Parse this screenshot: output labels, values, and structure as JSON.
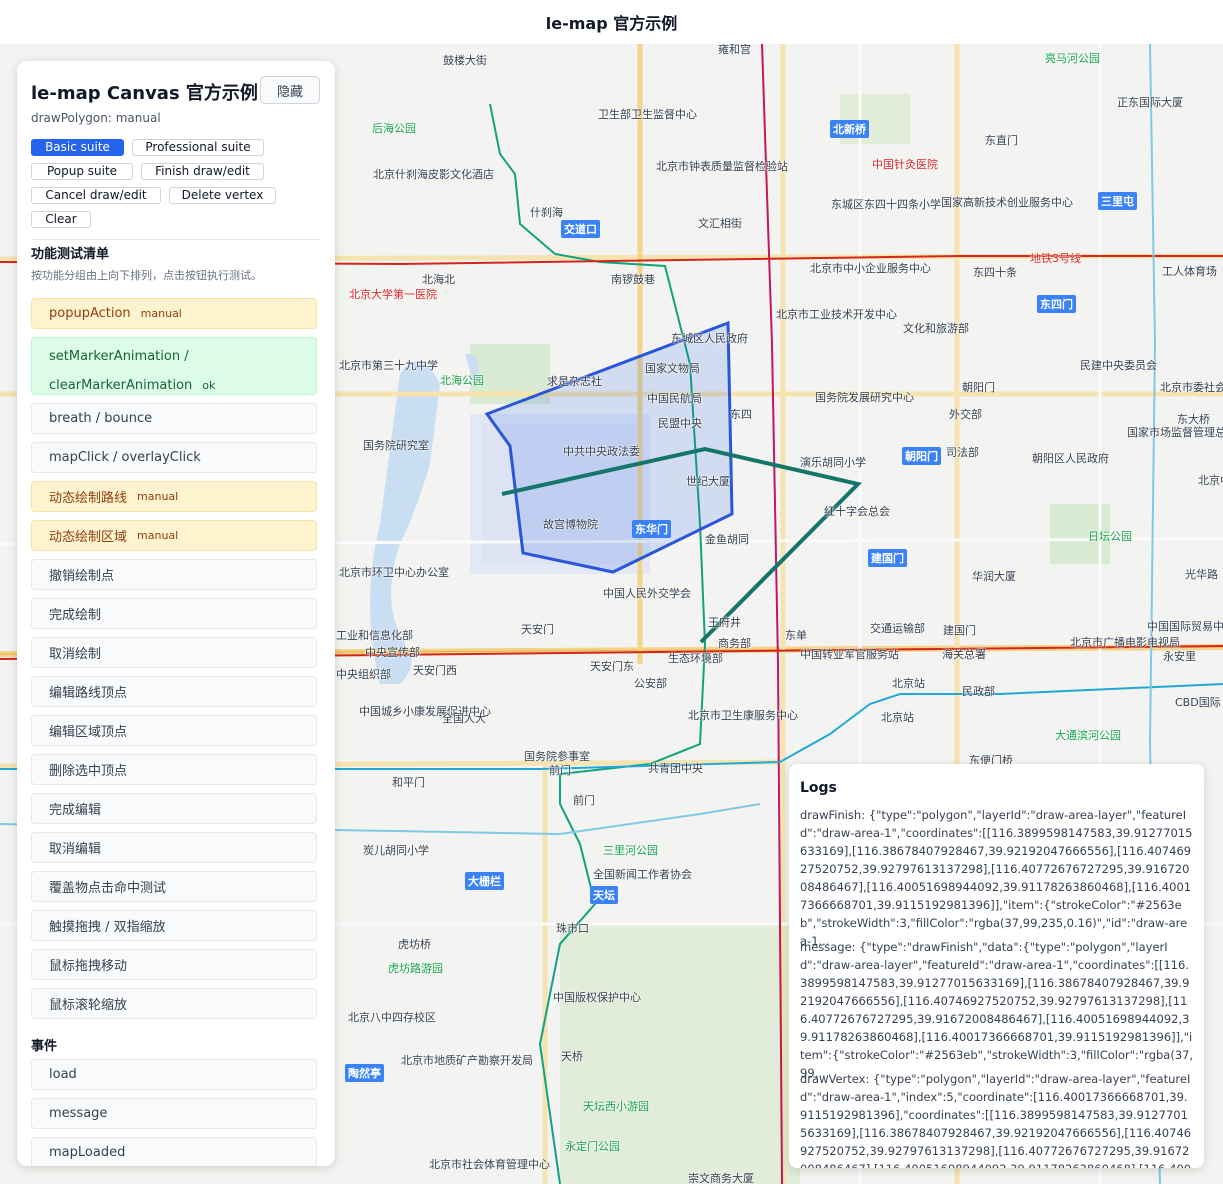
{
  "header": {
    "title": "le-map 官方示例"
  },
  "panel": {
    "title": "le-map Canvas 官方示例",
    "hide_label": "隐藏",
    "subtitle": "drawPolygon: manual",
    "buttons": [
      "Basic suite",
      "Professional suite",
      "Popup suite",
      "Finish draw/edit",
      "Cancel draw/edit",
      "Delete vertex",
      "Clear"
    ],
    "active_button": "Basic suite",
    "checklist_title": "功能测试清单",
    "checklist_desc": "按功能分组由上向下排列，点击按钮执行测试。",
    "items": [
      {
        "label": "popupAction",
        "tag": "manual",
        "status": "warn"
      },
      {
        "label": "setMarkerAnimation /",
        "label2": "clearMarkerAnimation",
        "tag": "ok",
        "status": "ok"
      },
      {
        "label": "breath / bounce",
        "tag": "",
        "status": "none"
      },
      {
        "label": "mapClick / overlayClick",
        "tag": "",
        "status": "none"
      },
      {
        "label": "动态绘制路线",
        "tag": "manual",
        "status": "warn"
      },
      {
        "label": "动态绘制区域",
        "tag": "manual",
        "status": "warn"
      },
      {
        "label": "撤销绘制点",
        "tag": "",
        "status": "none"
      },
      {
        "label": "完成绘制",
        "tag": "",
        "status": "none"
      },
      {
        "label": "取消绘制",
        "tag": "",
        "status": "none"
      },
      {
        "label": "编辑路线顶点",
        "tag": "",
        "status": "none"
      },
      {
        "label": "编辑区域顶点",
        "tag": "",
        "status": "none"
      },
      {
        "label": "删除选中顶点",
        "tag": "",
        "status": "none"
      },
      {
        "label": "完成编辑",
        "tag": "",
        "status": "none"
      },
      {
        "label": "取消编辑",
        "tag": "",
        "status": "none"
      },
      {
        "label": "覆盖物点击命中测试",
        "tag": "",
        "status": "none"
      },
      {
        "label": "触摸拖拽 / 双指缩放",
        "tag": "",
        "status": "none"
      },
      {
        "label": "鼠标拖拽移动",
        "tag": "",
        "status": "none"
      },
      {
        "label": "鼠标滚轮缩放",
        "tag": "",
        "status": "none"
      }
    ],
    "events_title": "事件",
    "events": [
      "load",
      "message",
      "mapLoaded"
    ]
  },
  "logs": {
    "title": "Logs",
    "entries": [
      "drawFinish: {\"type\":\"polygon\",\"layerId\":\"draw-area-layer\",\"featureId\":\"draw-area-1\",\"coordinates\":[[116.3899598147583,39.91277015633169],[116.38678407928467,39.92192047666556],[116.40746927520752,39.92797613137298],[116.40772676727295,39.91672008486467],[116.40051698944092,39.91178263860468],[116.40017366668701,39.9115192981396]],\"item\":{\"strokeColor\":\"#2563eb\",\"strokeWidth\":3,\"fillColor\":\"rgba(37,99,235,0.16)\",\"id\":\"draw-area-1...",
      "message: {\"type\":\"drawFinish\",\"data\":{\"type\":\"polygon\",\"layerId\":\"draw-area-layer\",\"featureId\":\"draw-area-1\",\"coordinates\":[[116.3899598147583,39.91277015633169],[116.38678407928467,39.92192047666556],[116.40746927520752,39.92797613137298],[116.40772676727295,39.91672008486467],[116.40051698944092,39.91178263860468],[116.40017366668701,39.9115192981396]],\"item\":{\"strokeColor\":\"#2563eb\",\"strokeWidth\":3,\"fillColor\":\"rgba(37,99,...",
      "drawVertex: {\"type\":\"polygon\",\"layerId\":\"draw-area-layer\",\"featureId\":\"draw-area-1\",\"index\":5,\"coordinate\":[116.40017366668701,39.9115192981396],\"coordinates\":[[116.3899598147583,39.91277015633169],[116.38678407928467,39.92192047666556],[116.40746927520752,39.92797613137298],[116.40772676727295,39.91672008486467],[116.40051698944092,39.91178263860468],[116.40017366668701,39.9..."
    ]
  },
  "map": {
    "labels": [
      "鼓楼大街",
      "雍和宫",
      "亮马河公园",
      "正东国际大厦",
      "卫生部卫生监督中心",
      "北新桥",
      "东直门",
      "后海公园",
      "中国针灸医院",
      "北京市钟表质量监督检验站",
      "北京什刹海皮影文化酒店",
      "东城区东四十四条小学",
      "国家高新技术创业服务中心",
      "三里屯",
      "什刹海",
      "交道口",
      "文汇相街",
      "地铁3号线",
      "北京市中小企业服务中心",
      "东四十条",
      "工人体育场",
      "北海北",
      "南锣鼓巷",
      "北京大学第一医院",
      "北京市工业技术开发中心",
      "东四门",
      "文化和旅游部",
      "东城区人民政府",
      "民建中央委员会",
      "北京市第三十九中学",
      "北海公园",
      "求是杂志社",
      "国家文物局",
      "北京市委社会工作委员会",
      "中国民航局",
      "国务院发展研究中心",
      "朝阳门",
      "东大桥",
      "外交部",
      "国家市场监督管理总局",
      "民盟中央",
      "东四",
      "国务院研究室",
      "中共中央政法委",
      "朝阳门",
      "司法部",
      "朝阳区人民政府",
      "演乐胡同小学",
      "世纪大厦",
      "北京中心",
      "日坛公园",
      "故宫博物院",
      "东华门",
      "红十字会总会",
      "北京市环卫中心办公室",
      "金鱼胡同",
      "建国门",
      "光华路",
      "中国人民外交学会",
      "华润大厦",
      "工业和信息化部",
      "王府井",
      "天安门",
      "东单",
      "交通运输部",
      "建国门",
      "中国国际贸易中心",
      "中央宣传部",
      "商务部",
      "北京市广播电影电视局",
      "永安里",
      "中央组织部",
      "天安门西",
      "天安门东",
      "公安部",
      "生态环境部",
      "中国转业军官服务站",
      "海关总署",
      "北京站",
      "民政部",
      "CBD国际",
      "中国城乡小康发展促进中心",
      "全国人大",
      "北京市卫生康服务中心",
      "北京站",
      "大通滨河公园",
      "国务院参事室",
      "前门",
      "共青团中央",
      "东便门桥",
      "和平门",
      "前门",
      "三里河公园",
      "炭儿胡同小学",
      "全国新闻工作者协会",
      "大栅栏",
      "天坛",
      "珠市口",
      "虎坊桥",
      "虎坊路游园",
      "中国版权保护中心",
      "北京八中四存校区",
      "北京市地质矿产勘察开发局",
      "天桥",
      "陶然亭",
      "天坛西小游园",
      "永定门公园",
      "北京市社会体育管理中心",
      "崇文商务大厦"
    ]
  }
}
